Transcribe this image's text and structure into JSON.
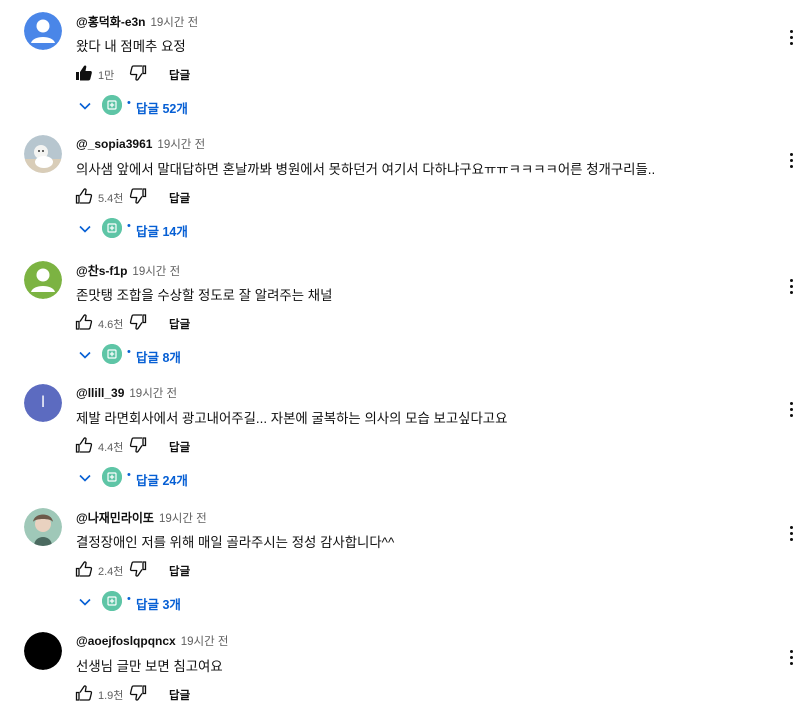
{
  "comments": [
    {
      "author": "@홍덕화-e3n",
      "time": "19시간 전",
      "text": "왔다 내 점메추 요정",
      "likes": "1만",
      "liked": true,
      "reply_label": "답글",
      "replies": "답글 52개",
      "avatar_color": "#4a86e8"
    },
    {
      "author": "@_sopia3961",
      "time": "19시간 전",
      "text": "의사샘 앞에서 말대답하면 혼날까봐 병원에서 못하던거 여기서 다하냐구요ㅠㅠㅋㅋㅋㅋ어른 청개구리들..",
      "likes": "5.4천",
      "liked": false,
      "reply_label": "답글",
      "replies": "답글 14개",
      "avatar_color": "#9eb4c4"
    },
    {
      "author": "@찬s-f1p",
      "time": "19시간 전",
      "text": "존맛탱 조합을 수상할 정도로 잘 알려주는 채널",
      "likes": "4.6천",
      "liked": false,
      "reply_label": "답글",
      "replies": "답글 8개",
      "avatar_color": "#7cb342"
    },
    {
      "author": "@llill_39",
      "time": "19시간 전",
      "text": "제발 라면회사에서 광고내어주길... 자본에 굴복하는 의사의 모습 보고싶다고요",
      "likes": "4.4천",
      "liked": false,
      "reply_label": "답글",
      "replies": "답글 24개",
      "avatar_color": "#5c6bc0",
      "avatar_letter": "l"
    },
    {
      "author": "@나재민라이또",
      "time": "19시간 전",
      "text": "결정장애인 저를 위해 매일 골라주시는 정성 감사합니다^^",
      "likes": "2.4천",
      "liked": false,
      "reply_label": "답글",
      "replies": "답글 3개",
      "avatar_color": "#8fb8a8"
    },
    {
      "author": "@aoejfoslqpqncx",
      "time": "19시간 전",
      "text": "선생님 글만 보면 침고여요",
      "likes": "1.9천",
      "liked": false,
      "reply_label": "답글",
      "avatar_color": "#000000"
    }
  ],
  "colors": {
    "link": "#065fd4",
    "reply_avatar": "#5ec5a6"
  }
}
